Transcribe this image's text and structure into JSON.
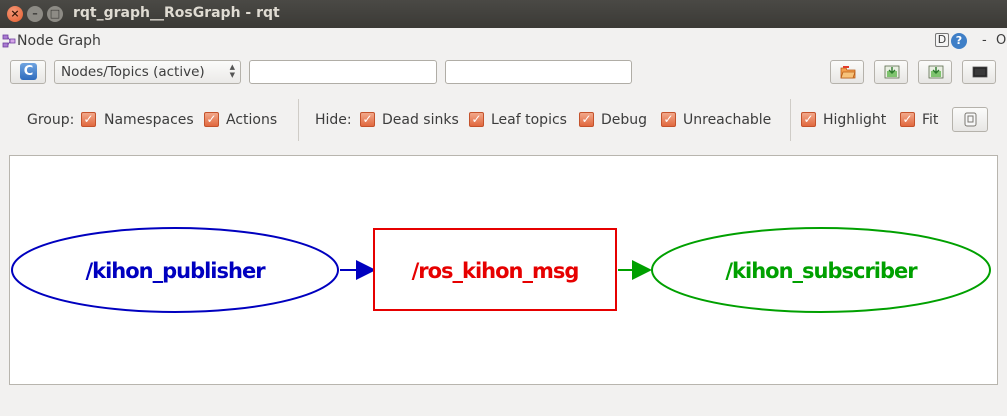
{
  "window": {
    "title": "rqt_graph__RosGraph - rqt",
    "close_glyph": "×",
    "minimize_glyph": "–",
    "maximize_glyph": "□"
  },
  "plugin": {
    "title": "Node Graph",
    "icon": "node-graph-icon",
    "help_d_label": "D",
    "help_q_label": "?",
    "dash_label": "-",
    "close_label": "O"
  },
  "toolbar": {
    "refresh_icon": "refresh-icon",
    "refresh_glyph": "C",
    "graph_type": "Nodes/Topics (active)",
    "filter_include_value": "",
    "filter_exclude_value": "",
    "load_icon": "folder-open-icon",
    "save_dot_icon": "save-icon",
    "save_svg_icon": "save-icon",
    "save_image_icon": "image-icon"
  },
  "options": {
    "group_label": "Group:",
    "group_items": [
      {
        "label": "Namespaces",
        "checked": true
      },
      {
        "label": "Actions",
        "checked": true
      }
    ],
    "hide_label": "Hide:",
    "hide_items": [
      {
        "label": "Dead sinks",
        "checked": true
      },
      {
        "label": "Leaf topics",
        "checked": true
      },
      {
        "label": "Debug",
        "checked": true
      },
      {
        "label": "Unreachable",
        "checked": true
      }
    ],
    "view_items": [
      {
        "label": "Highlight",
        "checked": true
      },
      {
        "label": "Fit",
        "checked": true
      }
    ],
    "check_glyph": "✓",
    "screenshot_icon": "screenshot-icon"
  },
  "graph": {
    "nodes": [
      {
        "label": "/kihon_publisher",
        "kind": "node",
        "color": "#0000bf"
      },
      {
        "label": "/ros_kihon_msg",
        "kind": "topic",
        "color": "#e60000"
      },
      {
        "label": "/kihon_subscriber",
        "kind": "node",
        "color": "#00a000"
      }
    ],
    "edges": [
      {
        "from": "/kihon_publisher",
        "to": "/ros_kihon_msg",
        "color": "#0000bf"
      },
      {
        "from": "/ros_kihon_msg",
        "to": "/kihon_subscriber",
        "color": "#00a000"
      }
    ]
  }
}
